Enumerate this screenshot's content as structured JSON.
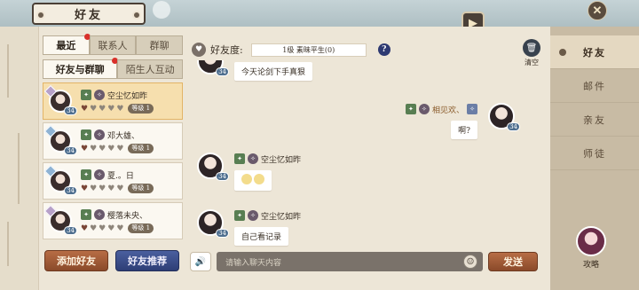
{
  "window": {
    "title": "好友"
  },
  "left": {
    "tabs_top": [
      {
        "label": "最近",
        "active": true,
        "dot": true
      },
      {
        "label": "联系人",
        "active": false
      },
      {
        "label": "群聊",
        "active": false
      }
    ],
    "tabs_sub": [
      {
        "label": "好友与群聊",
        "active": true,
        "dot": true
      },
      {
        "label": "陌生人互动",
        "active": false
      }
    ],
    "friends": [
      {
        "name": "空尘忆如昨",
        "level_label": "等级",
        "level": "1",
        "selected": true
      },
      {
        "name": "邓大雄、",
        "level_label": "等级",
        "level": "1",
        "selected": false
      },
      {
        "name": "夏.。日",
        "level_label": "等级",
        "level": "1",
        "selected": false
      },
      {
        "name": "樱落未央、",
        "level_label": "等级",
        "level": "1",
        "selected": false
      }
    ],
    "add_friend_label": "添加好友",
    "recommend_label": "好友推荐"
  },
  "chat": {
    "intimacy_label": "好友度:",
    "intimacy_value": "1级 素昧平生(0)",
    "help_label": "?",
    "clear_label": "清空",
    "messages": [
      {
        "side": "left",
        "sender": "",
        "text": "今天论剑下手真狠",
        "level": "34"
      },
      {
        "side": "right",
        "sender": "相见欢、",
        "text": "啊?",
        "level": "34"
      },
      {
        "side": "left",
        "sender": "空尘忆如昨",
        "text": "",
        "level": "34"
      },
      {
        "side": "left",
        "sender": "空尘忆如昨",
        "text": "自己看记录",
        "level": "34"
      }
    ],
    "input_placeholder": "请输入聊天内容",
    "send_label": "发送",
    "voice_icon": "voice-icon",
    "emoji_icon": "emoji-icon"
  },
  "nav": {
    "items": [
      {
        "label": "好友",
        "active": true
      },
      {
        "label": "邮件",
        "active": false
      },
      {
        "label": "亲友",
        "active": false
      },
      {
        "label": "师徒",
        "active": false
      }
    ],
    "guide_label": "攻略"
  },
  "colors": {
    "accent_brown": "#8a4a2a",
    "accent_blue": "#2e3e75",
    "selected": "#f6dfae"
  }
}
